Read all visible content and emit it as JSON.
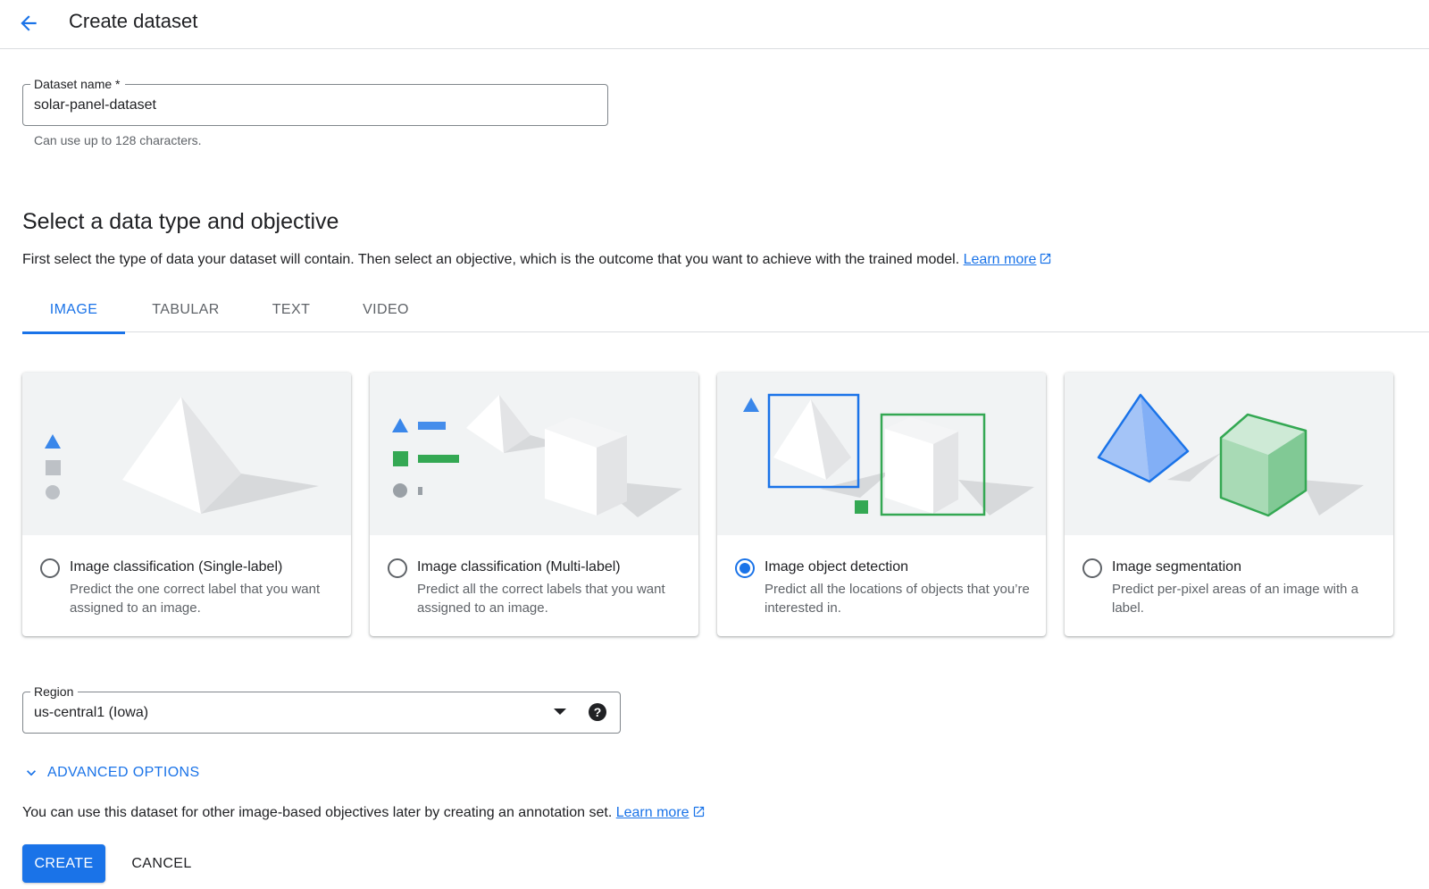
{
  "header": {
    "title": "Create dataset",
    "back_icon": "arrow-back-icon"
  },
  "dataset_name": {
    "label": "Dataset name *",
    "value": "solar-panel-dataset",
    "helper": "Can use up to 128 characters."
  },
  "section": {
    "title": "Select a data type and objective",
    "description": "First select the type of data your dataset will contain. Then select an objective, which is the outcome that you want to achieve with the trained model.",
    "learn_more": "Learn more"
  },
  "tabs": [
    {
      "label": "IMAGE",
      "active": true
    },
    {
      "label": "TABULAR",
      "active": false
    },
    {
      "label": "TEXT",
      "active": false
    },
    {
      "label": "VIDEO",
      "active": false
    }
  ],
  "objectives": [
    {
      "title": "Image classification (Single-label)",
      "description": "Predict the one correct label that you want assigned to an image.",
      "selected": false
    },
    {
      "title": "Image classification (Multi-label)",
      "description": "Predict all the correct labels that you want assigned to an image.",
      "selected": false
    },
    {
      "title": "Image object detection",
      "description": "Predict all the locations of objects that you’re interested in.",
      "selected": true
    },
    {
      "title": "Image segmentation",
      "description": "Predict per-pixel areas of an image with a label.",
      "selected": false
    }
  ],
  "region": {
    "label": "Region",
    "value": "us-central1 (Iowa)",
    "help_glyph": "?"
  },
  "advanced": {
    "label": "ADVANCED OPTIONS"
  },
  "footer": {
    "note": "You can use this dataset for other image-based objectives later by creating an annotation set.",
    "learn_more": "Learn more"
  },
  "actions": {
    "create_label": "CREATE",
    "cancel_label": "CANCEL"
  },
  "colors": {
    "accent": "#1a73e8",
    "green": "#34a853",
    "shape_gray": "#bdc1c6",
    "card_bg": "#f1f3f4"
  }
}
